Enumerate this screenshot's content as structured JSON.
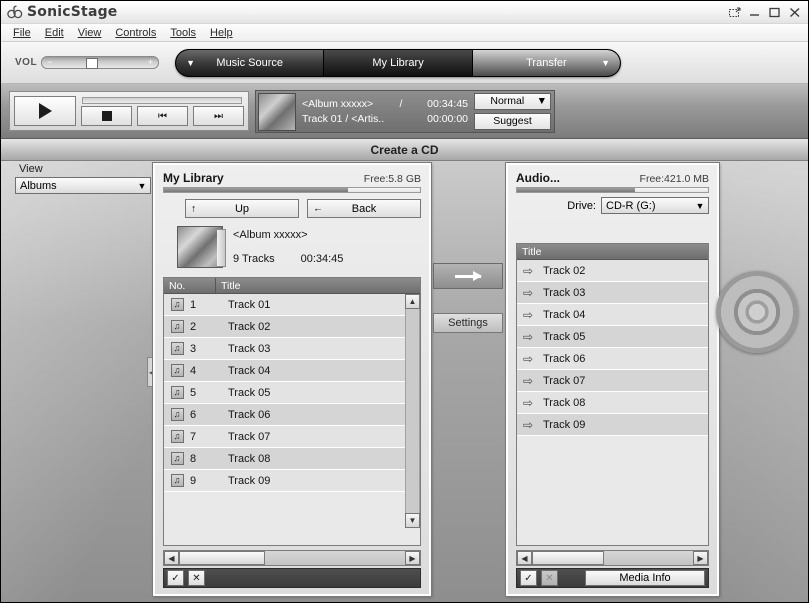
{
  "window": {
    "title": "SonicStage",
    "controls": [
      {
        "name": "rollup-button",
        "glyph": "⍑"
      },
      {
        "name": "minimize-button",
        "glyph": "–"
      },
      {
        "name": "maximize-button",
        "glyph": "□"
      },
      {
        "name": "close-button",
        "glyph": "✕"
      }
    ]
  },
  "menu": {
    "items": [
      "File",
      "Edit",
      "View",
      "Controls",
      "Tools",
      "Help"
    ]
  },
  "toolbar": {
    "volume_label": "VOL",
    "volume_minus": "−",
    "volume_plus": "+",
    "tabs": [
      {
        "label": "Music Source",
        "caret": "▼"
      },
      {
        "label": "My Library",
        "caret": ""
      },
      {
        "label": "Transfer",
        "caret": "▼"
      }
    ]
  },
  "player": {
    "play_label": "",
    "stop_label": "",
    "prev_label": "⏮",
    "next_label": "⏭",
    "album": "<Album xxxxx>",
    "separator": "/",
    "total_time": "00:34:45",
    "track": "Track 01 / <Artis..",
    "elapsed_time": "00:00:00",
    "mode": "Normal",
    "mode_caret": "▼",
    "suggest_label": "Suggest"
  },
  "page": {
    "title": "Create a CD"
  },
  "view_pane": {
    "label": "View",
    "selected": "Albums",
    "caret": "▼",
    "collapse_glyph": "◀"
  },
  "library": {
    "title": "My Library",
    "free": "Free:5.8 GB",
    "meter_percent": 72,
    "up_label": "Up",
    "up_icon": "↑",
    "back_label": "Back",
    "back_icon": "←",
    "album_name": "<Album xxxxx>",
    "track_count": "9 Tracks",
    "album_time": "00:34:45",
    "columns": [
      "No.",
      "Title"
    ],
    "note_icon": "♫",
    "rows": [
      {
        "no": "1",
        "title": "Track 01"
      },
      {
        "no": "2",
        "title": "Track 02"
      },
      {
        "no": "3",
        "title": "Track 03"
      },
      {
        "no": "4",
        "title": "Track 04"
      },
      {
        "no": "5",
        "title": "Track 05"
      },
      {
        "no": "6",
        "title": "Track 06"
      },
      {
        "no": "7",
        "title": "Track 07"
      },
      {
        "no": "8",
        "title": "Track 08"
      },
      {
        "no": "9",
        "title": "Track 09"
      }
    ],
    "footer": {
      "check_glyph": "✓",
      "cross_glyph": "✕"
    }
  },
  "transfer": {
    "arrow_name": "transfer-right-arrow",
    "settings_label": "Settings"
  },
  "cd": {
    "title": "Audio...",
    "free": "Free:421.0 MB",
    "meter_percent": 62,
    "drive_label": "Drive:",
    "drive_value": "CD-R (G:)",
    "drive_caret": "▼",
    "columns": [
      "Title"
    ],
    "row_icon": "⇨",
    "rows": [
      {
        "title": "Track 02"
      },
      {
        "title": "Track 03"
      },
      {
        "title": "Track 04"
      },
      {
        "title": "Track 05"
      },
      {
        "title": "Track 06"
      },
      {
        "title": "Track 07"
      },
      {
        "title": "Track 08"
      },
      {
        "title": "Track 09"
      }
    ],
    "footer": {
      "check_glyph": "✓",
      "cross_glyph": "✕",
      "media_info_label": "Media Info"
    }
  },
  "scroll": {
    "up_glyph": "▲",
    "down_glyph": "▼",
    "left_glyph": "◀",
    "right_glyph": "▶"
  },
  "colors": {
    "accent": "#6e6e6e",
    "panel_bg": "#dcdcdc",
    "header_bg": "#6e6e6e",
    "footer_bg": "#3b3b3b"
  }
}
